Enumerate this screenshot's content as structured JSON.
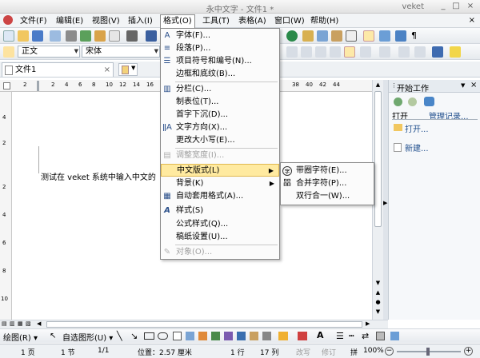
{
  "window": {
    "title": "永中文字 - 文件1 *",
    "brand": "veket",
    "minimize": "_",
    "maximize": "□",
    "close": "×"
  },
  "menubar": [
    "文件(F)",
    "编辑(E)",
    "视图(V)",
    "插入(I)",
    "格式(O)",
    "工具(T)",
    "表格(A)",
    "窗口(W)",
    "帮助(H)"
  ],
  "toolbar2": {
    "style": "正文",
    "font": "宋体"
  },
  "tabs": {
    "doc": "文件1"
  },
  "ruler_ticks": [
    "2",
    "2",
    "4",
    "6",
    "8",
    "10",
    "12",
    "14",
    "16",
    "18",
    "20",
    "22",
    "24",
    "26",
    "28",
    "30",
    "32",
    "34",
    "36",
    "38",
    "40",
    "42",
    "44"
  ],
  "vruler_ticks": [
    "4",
    "2",
    "2",
    "4",
    "6",
    "8",
    "10"
  ],
  "document": {
    "text": "测试在 veket 系统中输入中文的"
  },
  "format_menu": [
    {
      "label": "字体(F)...",
      "icon": "A",
      "disabled": false
    },
    {
      "label": "段落(P)...",
      "icon": "≡",
      "disabled": false
    },
    {
      "label": "项目符号和编号(N)...",
      "icon": "☰",
      "disabled": false
    },
    {
      "label": "边框和底纹(B)...",
      "icon": "",
      "disabled": false
    },
    {
      "label": "分栏(C)...",
      "icon": "▥",
      "disabled": false
    },
    {
      "label": "制表位(T)...",
      "icon": "",
      "disabled": false
    },
    {
      "label": "首字下沉(D)...",
      "icon": "",
      "disabled": false
    },
    {
      "label": "文字方向(X)...",
      "icon": "ǁA",
      "disabled": false
    },
    {
      "label": "更改大小写(E)...",
      "icon": "",
      "disabled": false
    },
    {
      "label": "调整宽度(I)...",
      "icon": "▤",
      "disabled": true
    },
    {
      "label": "中文版式(L)",
      "icon": "",
      "disabled": false,
      "submenu": true
    },
    {
      "label": "背景(K)",
      "icon": "",
      "disabled": false,
      "submenu": true
    },
    {
      "label": "自动套用格式(A)...",
      "icon": "▦",
      "disabled": false
    },
    {
      "label": "样式(S)",
      "icon": "A",
      "disabled": false
    },
    {
      "label": "公式样式(Q)...",
      "icon": "",
      "disabled": false
    },
    {
      "label": "稿纸设置(U)...",
      "icon": "",
      "disabled": false
    },
    {
      "label": "对象(O)...",
      "icon": "✎",
      "disabled": true
    }
  ],
  "submenu": [
    {
      "label": "带圈字符(E)...",
      "icon": "字"
    },
    {
      "label": "合并字符(P)...",
      "icon": "㗊"
    },
    {
      "label": "双行合一(W)...",
      "icon": ""
    }
  ],
  "taskpane": {
    "title": "开始工作",
    "section_left": "打开",
    "section_right": "管理记录...",
    "open_link": "打开...",
    "new_link": "新建..."
  },
  "bottom_toolbar": {
    "draw": "绘图(R)",
    "autoshape": "自选图形(U)"
  },
  "statusbar": {
    "page": "1 页",
    "section": "1 节",
    "pages": "1/1",
    "position": "位置：2.57 厘米",
    "line": "1 行",
    "col": "17 列",
    "mode1": "改写",
    "mode2": "修订",
    "ime": "拼",
    "zoom": "100%"
  }
}
